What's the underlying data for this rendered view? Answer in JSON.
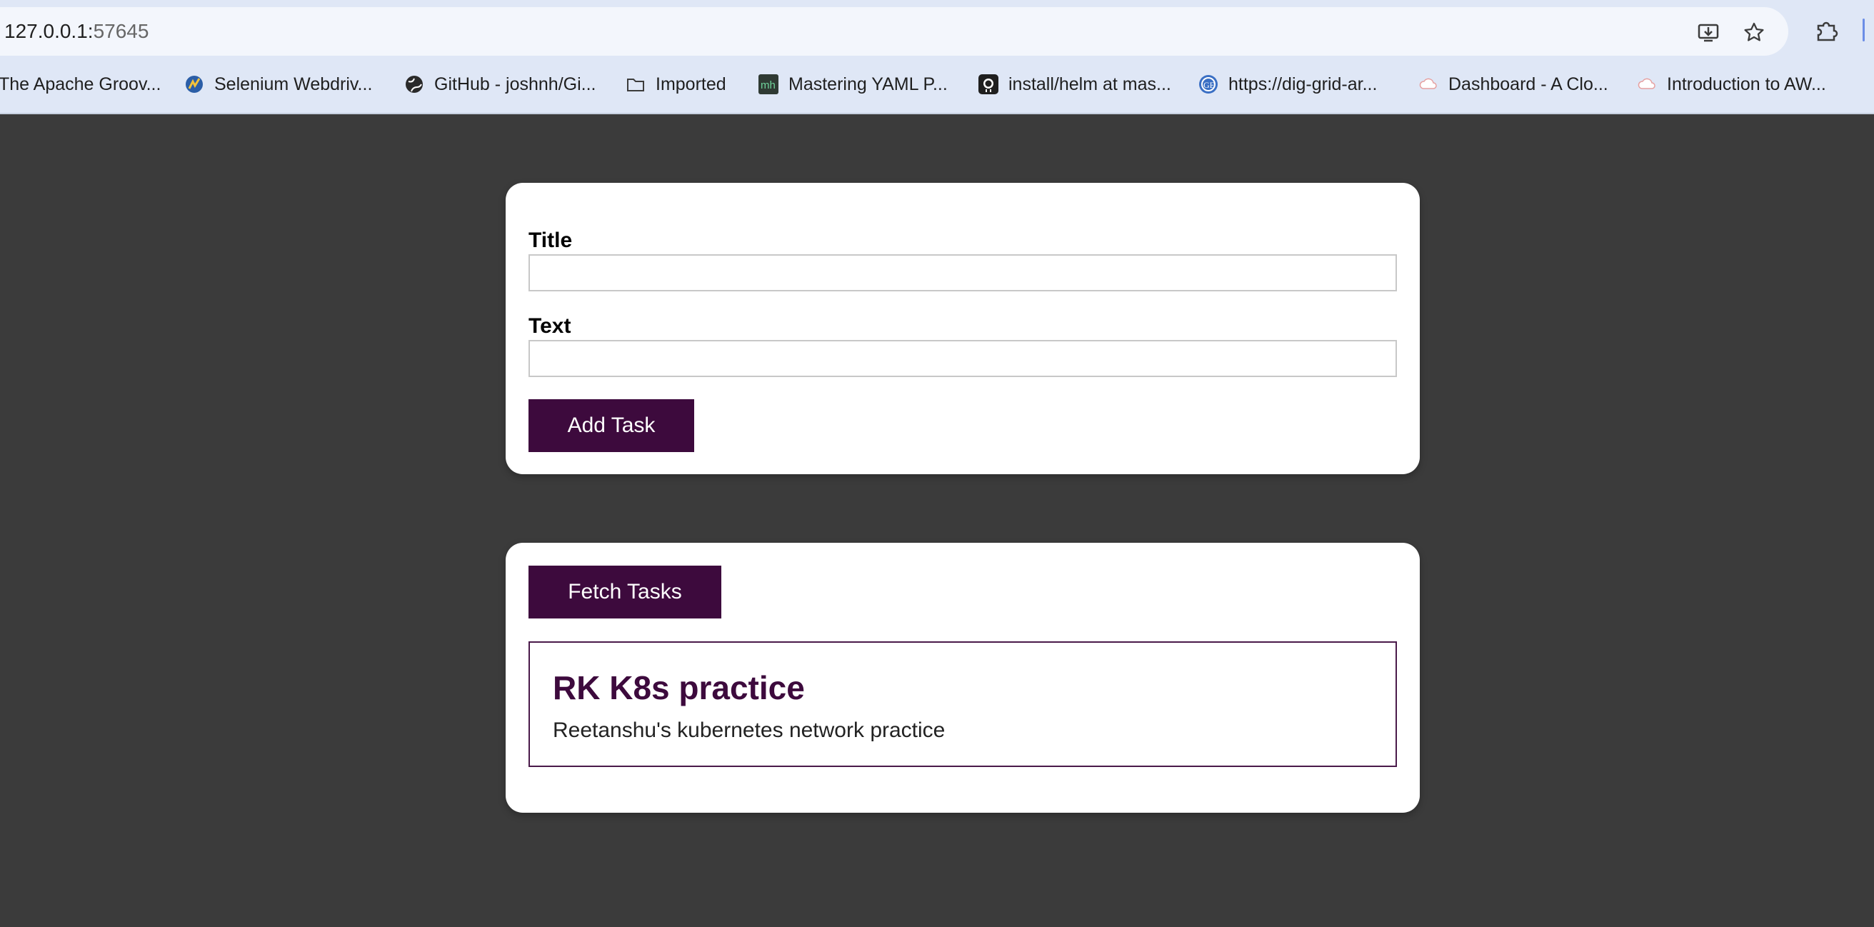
{
  "browser": {
    "url_host": "127.0.0.1:",
    "url_port": "57645",
    "bookmarks": [
      {
        "label": "The Apache Groov...",
        "icon": "groovy-icon"
      },
      {
        "label": "Selenium Webdriv...",
        "icon": "selenium-icon"
      },
      {
        "label": "GitHub - joshnh/Gi...",
        "icon": "globe-icon"
      },
      {
        "label": "Imported",
        "icon": "folder-icon"
      },
      {
        "label": "Mastering YAML P...",
        "icon": "mh-icon"
      },
      {
        "label": "install/helm at mas...",
        "icon": "github-icon"
      },
      {
        "label": "https://dig-grid-ar...",
        "icon": "ge-icon"
      },
      {
        "label": "Dashboard - A Clo...",
        "icon": "cloud-icon"
      },
      {
        "label": "Introduction to AW...",
        "icon": "cloud-icon"
      }
    ]
  },
  "form": {
    "title_label": "Title",
    "title_value": "",
    "text_label": "Text",
    "text_value": "",
    "add_button": "Add Task"
  },
  "tasks": {
    "fetch_button": "Fetch Tasks",
    "items": [
      {
        "title": "RK K8s practice",
        "text": "Reetanshu's kubernetes network practice"
      }
    ]
  },
  "colors": {
    "background": "#3b3b3b",
    "button": "#3d0a3d",
    "task_title": "#3d0a3d"
  }
}
